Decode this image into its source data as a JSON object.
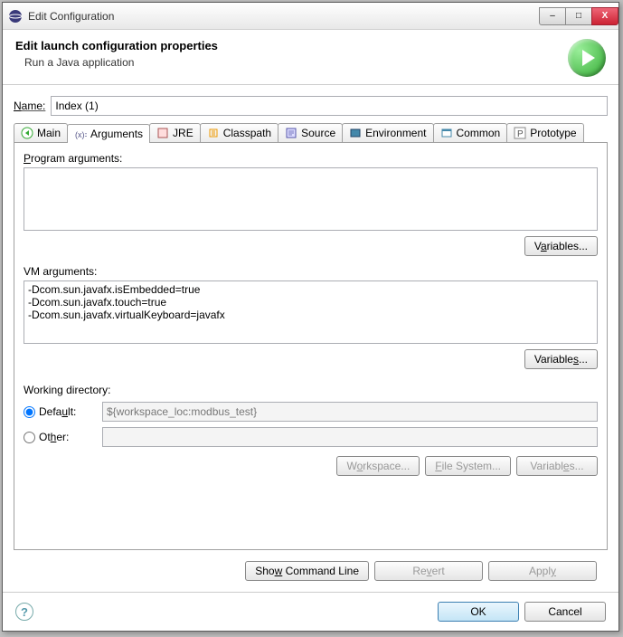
{
  "window": {
    "title": "Edit Configuration",
    "minimize": "–",
    "maximize": "□",
    "close": "X"
  },
  "header": {
    "title": "Edit launch configuration properties",
    "desc": "Run a Java application"
  },
  "name": {
    "label": "Name:",
    "value": "Index (1)"
  },
  "tabs": {
    "main": "Main",
    "arguments": "Arguments",
    "jre": "JRE",
    "classpath": "Classpath",
    "source": "Source",
    "environment": "Environment",
    "common": "Common",
    "prototype": "Prototype"
  },
  "arguments": {
    "program_label": "Program arguments:",
    "program_value": "",
    "variables_btn": "Variables...",
    "vm_label": "VM arguments:",
    "vm_value": "-Dcom.sun.javafx.isEmbedded=true\n-Dcom.sun.javafx.touch=true\n-Dcom.sun.javafx.virtualKeyboard=javafx",
    "working_dir_label": "Working directory:",
    "default_label": "Default:",
    "default_value": "${workspace_loc:modbus_test}",
    "other_label": "Other:",
    "other_value": "",
    "workspace_btn": "Workspace...",
    "filesystem_btn": "File System...",
    "variables2_btn": "Variables..."
  },
  "footer": {
    "show_cmd": "Show Command Line",
    "revert": "Revert",
    "apply": "Apply",
    "ok": "OK",
    "cancel": "Cancel"
  }
}
